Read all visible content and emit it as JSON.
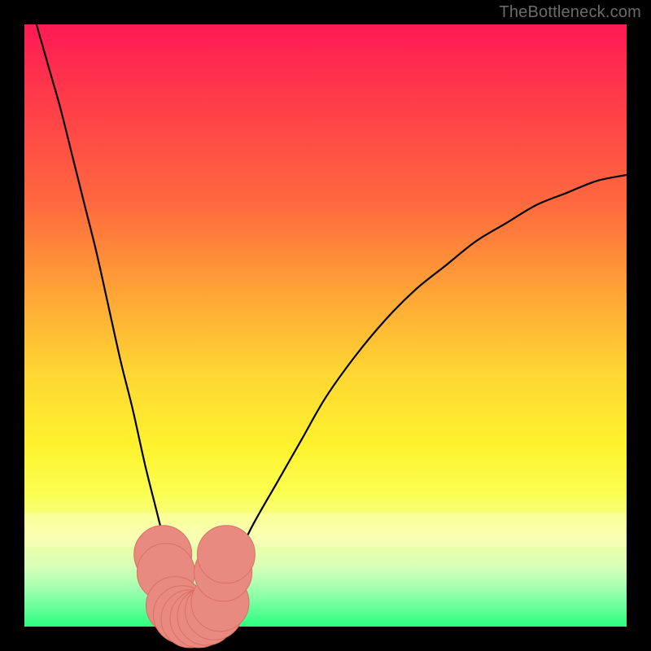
{
  "watermark": "TheBottleneck.com",
  "colors": {
    "gradient_top": "#ff1a54",
    "gradient_bottom": "#2bff7f",
    "curve": "#000000",
    "marker_fill": "#e98a80",
    "marker_stroke": "#da6f64",
    "page_bg": "#000000"
  },
  "chart_data": {
    "type": "line",
    "title": "",
    "xlabel": "",
    "ylabel": "",
    "xlim": [
      0,
      100
    ],
    "ylim": [
      0,
      100
    ],
    "grid": false,
    "legend": false,
    "comment": "Axes are unlabeled; values below are normalized 0–100 along each axis, estimated from pixel positions. Two visually separate curve segments meet near the bottom at roughly x≈28.",
    "series": [
      {
        "name": "left_branch",
        "x": [
          2,
          4,
          6,
          8,
          10,
          12,
          14,
          16,
          18,
          20,
          22,
          24,
          25,
          26,
          27,
          28
        ],
        "y": [
          100,
          93,
          86,
          78,
          70,
          62,
          53,
          44,
          36,
          27,
          19,
          11,
          7,
          4,
          2,
          1
        ]
      },
      {
        "name": "right_branch",
        "x": [
          28,
          30,
          32,
          35,
          38,
          42,
          46,
          50,
          55,
          60,
          65,
          70,
          75,
          80,
          85,
          90,
          95,
          100
        ],
        "y": [
          1,
          3,
          6,
          11,
          17,
          24,
          31,
          38,
          45,
          51,
          56,
          60,
          64,
          67,
          70,
          72,
          74,
          75
        ]
      }
    ],
    "markers": {
      "comment": "Small salmon-colored dots clustered at the curve valley, positions in same 0–100 normalized space.",
      "points": [
        {
          "x": 23.0,
          "y": 12.0
        },
        {
          "x": 23.5,
          "y": 9.0
        },
        {
          "x": 25.0,
          "y": 3.5
        },
        {
          "x": 26.2,
          "y": 2.0
        },
        {
          "x": 27.5,
          "y": 1.3
        },
        {
          "x": 29.0,
          "y": 1.3
        },
        {
          "x": 30.2,
          "y": 1.7
        },
        {
          "x": 31.5,
          "y": 2.6
        },
        {
          "x": 32.5,
          "y": 4.0
        },
        {
          "x": 33.0,
          "y": 9.0
        },
        {
          "x": 33.5,
          "y": 12.0
        }
      ],
      "radius": 1.2
    }
  }
}
